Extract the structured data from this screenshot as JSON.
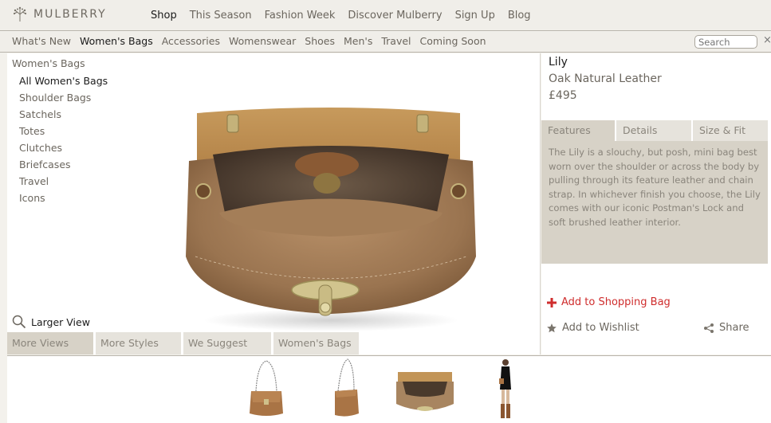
{
  "header": {
    "logo_text": "MULBERRY",
    "logo_icon": "tree-icon",
    "nav": [
      {
        "label": "Shop",
        "active": true
      },
      {
        "label": "This Season"
      },
      {
        "label": "Fashion Week"
      },
      {
        "label": "Discover Mulberry"
      },
      {
        "label": "Sign Up"
      },
      {
        "label": "Blog"
      }
    ]
  },
  "category_bar": {
    "items": [
      {
        "label": "What's New"
      },
      {
        "label": "Women's Bags",
        "active": true
      },
      {
        "label": "Accessories"
      },
      {
        "label": "Womenswear"
      },
      {
        "label": "Shoes"
      },
      {
        "label": "Men's"
      },
      {
        "label": "Travel"
      },
      {
        "label": "Coming Soon"
      }
    ],
    "search_placeholder": "Search"
  },
  "sidebar": {
    "title": "Women's Bags",
    "items": [
      {
        "label": "All Women's Bags",
        "active": true
      },
      {
        "label": "Shoulder Bags"
      },
      {
        "label": "Satchels"
      },
      {
        "label": "Totes"
      },
      {
        "label": "Clutches"
      },
      {
        "label": "Briefcases"
      },
      {
        "label": "Travel"
      },
      {
        "label": "Icons"
      }
    ]
  },
  "viewer": {
    "larger_view_label": "Larger View",
    "tabs": [
      {
        "label": "More Views",
        "active": true
      },
      {
        "label": "More Styles"
      },
      {
        "label": "We Suggest"
      },
      {
        "label": "Women's Bags"
      }
    ]
  },
  "product": {
    "name": "Lily",
    "material": "Oak Natural Leather",
    "price": "£495",
    "detail_tabs": [
      {
        "label": "Features",
        "active": true
      },
      {
        "label": "Details"
      },
      {
        "label": "Size & Fit"
      }
    ],
    "description": "The Lily is a slouchy, but posh, mini bag best worn over the shoulder or across the body by pulling through its feature leather and chain strap. In whichever finish you choose, the Lily comes with our iconic Postman's Lock and soft brushed leather interior.",
    "add_to_bag_label": "Add to Shopping Bag",
    "wishlist_label": "Add to Wishlist",
    "share_label": "Share"
  },
  "colors": {
    "accent_red": "#cf2d2d",
    "tab_active": "#d7d2c7",
    "tab_inactive": "#e6e3dc",
    "leather": "#9b7449"
  }
}
